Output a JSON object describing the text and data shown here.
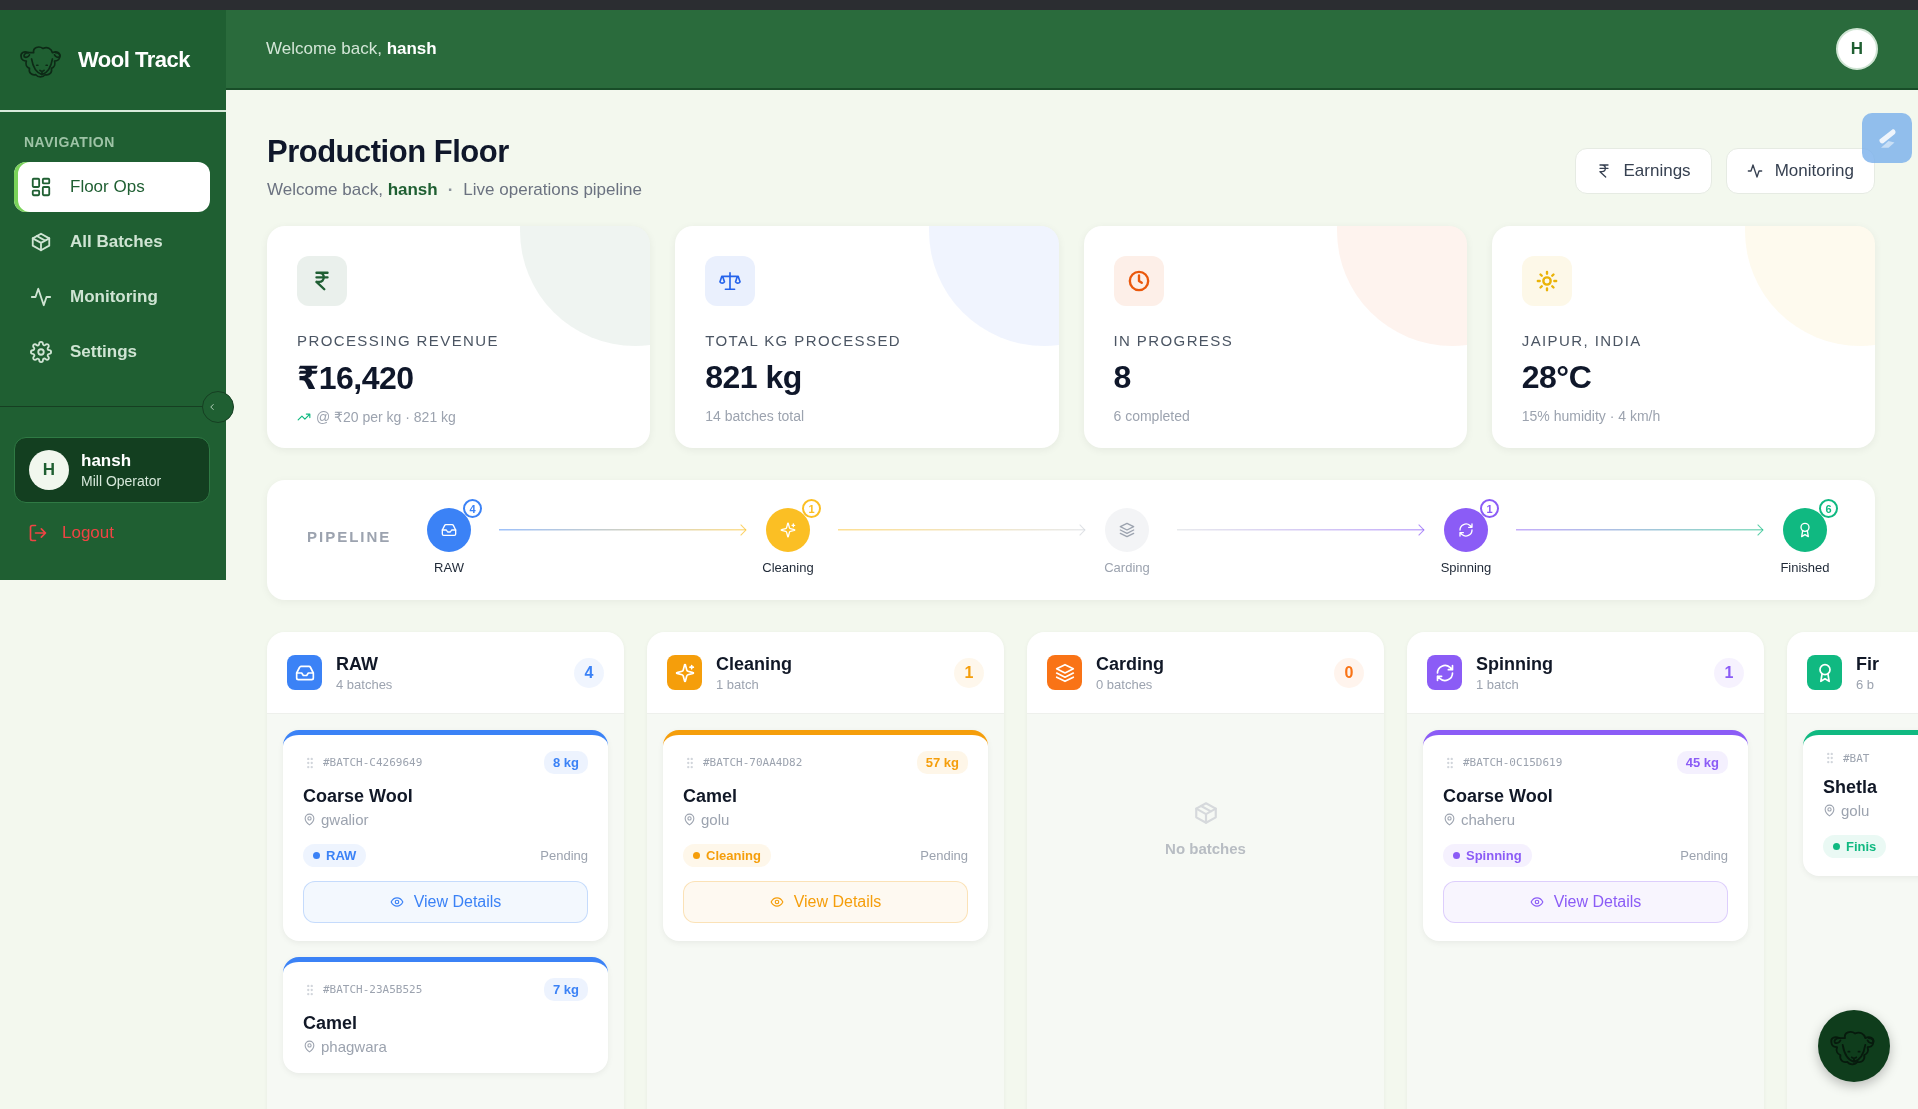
{
  "app": {
    "name": "Wool Track"
  },
  "sidebar": {
    "section_label": "NAVIGATION",
    "items": [
      {
        "label": "Floor Ops",
        "selected": true
      },
      {
        "label": "All Batches",
        "selected": false
      },
      {
        "label": "Monitoring",
        "selected": false
      },
      {
        "label": "Settings",
        "selected": false
      }
    ],
    "user": {
      "initial": "H",
      "name": "hansh",
      "role": "Mill Operator"
    },
    "logout": "Logout"
  },
  "header": {
    "greeting": "Welcome back, **hansh**",
    "avatar": "H"
  },
  "page": {
    "title": "Production Floor",
    "greeting": "Welcome back, **hansh**",
    "separator": "·",
    "subtitle": "Live operations pipeline",
    "actions": [
      {
        "label": "Earnings"
      },
      {
        "label": "Monitoring"
      }
    ]
  },
  "stats": [
    {
      "label": "PROCESSING REVENUE",
      "value": "₹16,420",
      "note": "@ ₹20 per kg · 821 kg",
      "color": "#1f5e33",
      "trend": true
    },
    {
      "label": "TOTAL KG PROCESSED",
      "value": "821 kg",
      "note": "14 batches total",
      "color": "#2563eb",
      "trend": false
    },
    {
      "label": "IN PROGRESS",
      "value": "8",
      "note": "6 completed",
      "color": "#ea580c",
      "trend": false
    },
    {
      "label": "JAIPUR, INDIA",
      "value": "28°C",
      "note": "15% humidity · 4 km/h",
      "color": "#eab308",
      "trend": false
    }
  ],
  "pipeline": {
    "label": "PIPELINE",
    "stages": [
      {
        "kind": "raw",
        "name": "RAW",
        "count": "4",
        "active": true,
        "color": "#3b82f6"
      },
      {
        "kind": "cleaning",
        "name": "Cleaning",
        "count": "1",
        "active": true,
        "color": "#fbbf24"
      },
      {
        "kind": "carding",
        "name": "Carding",
        "active": false
      },
      {
        "kind": "spinning",
        "name": "Spinning",
        "count": "1",
        "active": true,
        "color": "#8b5cf6"
      },
      {
        "kind": "finished",
        "name": "Finished",
        "count": "6",
        "active": true,
        "color": "#10b981"
      }
    ]
  },
  "columns": [
    {
      "kind": "raw",
      "title": "RAW",
      "subtitle": "4 batches",
      "count": "4",
      "color": "#3b82f6",
      "cards": [
        {
          "id": "#BATCH-C4269649",
          "weight": "8 kg",
          "name": "Coarse Wool",
          "location": "gwalior",
          "status": "RAW",
          "state": "Pending",
          "button": "View Details"
        },
        {
          "id": "#BATCH-23A5B525",
          "weight": "7 kg",
          "name": "Camel",
          "location": "phagwara"
        }
      ]
    },
    {
      "kind": "cleaning",
      "title": "Cleaning",
      "subtitle": "1 batch",
      "count": "1",
      "color": "#f59e0b",
      "cards": [
        {
          "id": "#BATCH-70AA4D82",
          "weight": "57 kg",
          "name": "Camel",
          "location": "golu",
          "status": "Cleaning",
          "state": "Pending",
          "button": "View Details"
        }
      ]
    },
    {
      "kind": "carding",
      "title": "Carding",
      "subtitle": "0 batches",
      "count": "0",
      "color": "#f97316",
      "empty": "No batches"
    },
    {
      "kind": "spinning",
      "title": "Spinning",
      "subtitle": "1 batch",
      "count": "1",
      "color": "#8b5cf6",
      "cards": [
        {
          "id": "#BATCH-0C15D619",
          "weight": "45 kg",
          "name": "Coarse Wool",
          "location": "chaheru",
          "status": "Spinning",
          "state": "Pending",
          "button": "View Details"
        }
      ]
    },
    {
      "kind": "finished",
      "title": "Fir",
      "subtitle": "6 b",
      "color": "#10b981",
      "cards": [
        {
          "id": "#BAT",
          "name": "Shetla",
          "location": "golu",
          "status": "Finis"
        }
      ]
    }
  ]
}
